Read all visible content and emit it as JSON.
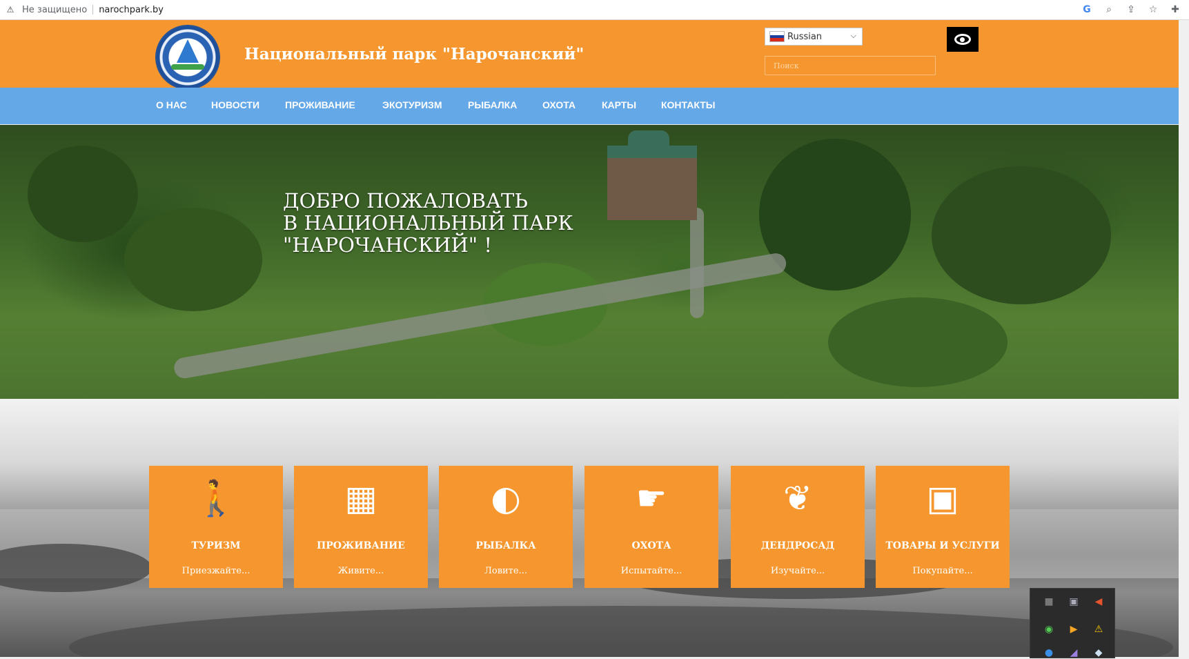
{
  "browser": {
    "security_label": "Не защищено",
    "url": "narochpark.by",
    "tool_icons": [
      "google-icon",
      "search-icon",
      "share-icon",
      "star-icon",
      "extensions-icon"
    ]
  },
  "header": {
    "site_title": "Национальный парк \"Нарочанский\"",
    "language": "Russian",
    "search_placeholder": "Поиск",
    "accent_color": "#f5972e"
  },
  "nav": {
    "color": "#64a8e8",
    "items": [
      "О НАС",
      "НОВОСТИ",
      "ПРОЖИВАНИЕ",
      "ЭКОТУРИЗМ",
      "РЫБАЛКА",
      "ОХОТА",
      "КАРТЫ",
      "КОНТАКТЫ"
    ]
  },
  "hero": {
    "title": "ДОБРО ПОЖАЛОВАТЬ\nВ НАЦИОНАЛЬНЫЙ ПАРК\n\"НАРОЧАНСКИЙ\" !"
  },
  "services": [
    {
      "title": "ТУРИЗМ",
      "subtitle": "Приезжайте...",
      "icon": "hiker-icon"
    },
    {
      "title": "ПРОЖИВАНИЕ",
      "subtitle": "Живите...",
      "icon": "building-icon"
    },
    {
      "title": "РЫБАЛКА",
      "subtitle": "Ловите...",
      "icon": "fish-icon"
    },
    {
      "title": "ОХОТА",
      "subtitle": "Испытайте...",
      "icon": "hand-pointer-icon"
    },
    {
      "title": "ДЕНДРОСАД",
      "subtitle": "Изучайте...",
      "icon": "leaf-icon"
    },
    {
      "title": "ТОВАРЫ И УСЛУГИ",
      "subtitle": "Покупайте...",
      "icon": "money-icon"
    }
  ]
}
